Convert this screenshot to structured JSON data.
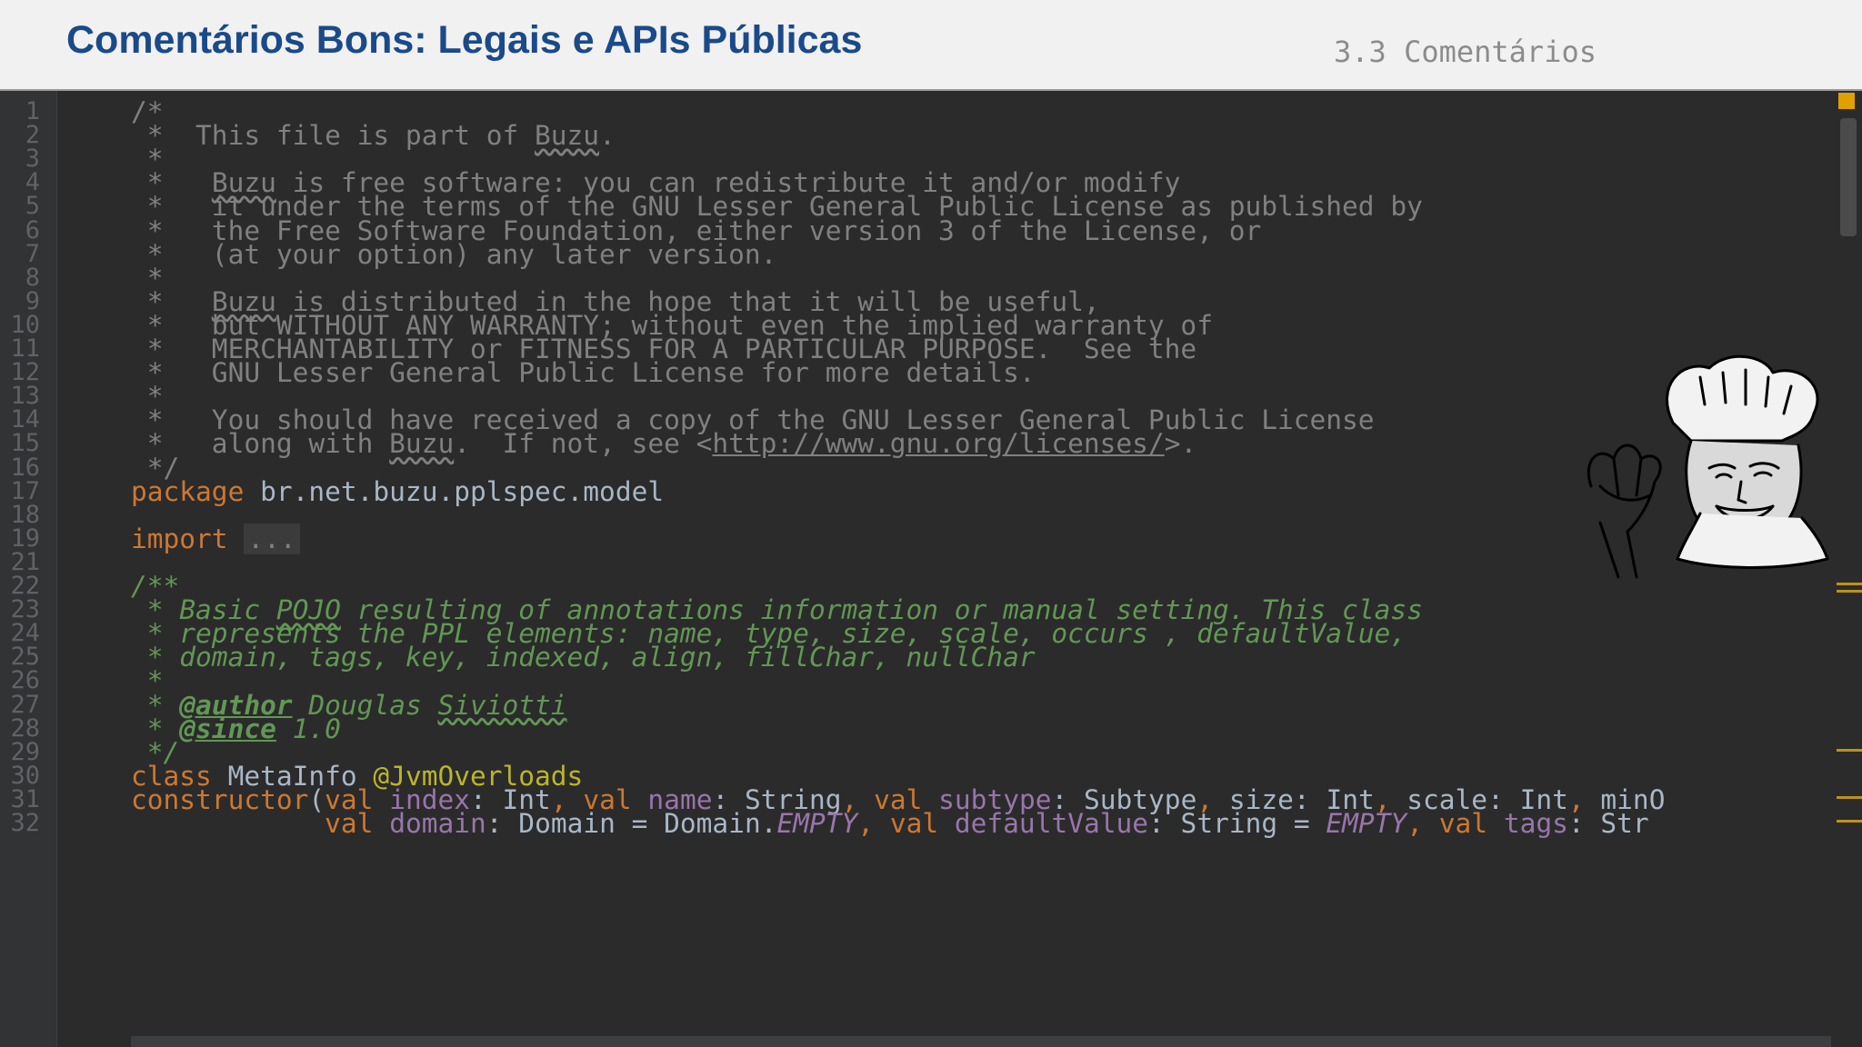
{
  "slide": {
    "title": "Comentários Bons: Legais e APIs Públicas",
    "section": "3.3 Comentários"
  },
  "editor": {
    "language": "Kotlin",
    "lines": [
      {
        "n": "1",
        "segments": [
          {
            "t": "/*",
            "c": "comment"
          }
        ]
      },
      {
        "n": "2",
        "segments": [
          {
            "t": " *  This file is part of ",
            "c": "comment"
          },
          {
            "t": "Buzu",
            "c": "comment squig"
          },
          {
            "t": ".",
            "c": "comment"
          }
        ]
      },
      {
        "n": "3",
        "segments": [
          {
            "t": " *",
            "c": "comment"
          }
        ]
      },
      {
        "n": "4",
        "segments": [
          {
            "t": " *   ",
            "c": "comment"
          },
          {
            "t": "Buzu",
            "c": "comment squig"
          },
          {
            "t": " is free software: you can redistribute it and/or modify",
            "c": "comment"
          }
        ]
      },
      {
        "n": "5",
        "segments": [
          {
            "t": " *   it under the terms of the GNU Lesser General Public License as published by",
            "c": "comment"
          }
        ]
      },
      {
        "n": "6",
        "segments": [
          {
            "t": " *   the Free Software Foundation, either version 3 of the License, or",
            "c": "comment"
          }
        ]
      },
      {
        "n": "7",
        "segments": [
          {
            "t": " *   (at your option) any later version.",
            "c": "comment"
          }
        ]
      },
      {
        "n": "8",
        "segments": [
          {
            "t": " *",
            "c": "comment"
          }
        ]
      },
      {
        "n": "9",
        "segments": [
          {
            "t": " *   ",
            "c": "comment"
          },
          {
            "t": "Buzu",
            "c": "comment squig"
          },
          {
            "t": " is distributed in the hope that it will be useful,",
            "c": "comment"
          }
        ]
      },
      {
        "n": "10",
        "segments": [
          {
            "t": " *   but WITHOUT ANY WARRANTY; without even the implied warranty of",
            "c": "comment"
          }
        ]
      },
      {
        "n": "11",
        "segments": [
          {
            "t": " *   MERCHANTABILITY or FITNESS FOR A PARTICULAR PURPOSE.  See the",
            "c": "comment"
          }
        ]
      },
      {
        "n": "12",
        "segments": [
          {
            "t": " *   GNU Lesser General Public License for more details.",
            "c": "comment"
          }
        ]
      },
      {
        "n": "13",
        "segments": [
          {
            "t": " *",
            "c": "comment"
          }
        ]
      },
      {
        "n": "14",
        "segments": [
          {
            "t": " *   You should have received a copy of the GNU Lesser General Public License",
            "c": "comment"
          }
        ]
      },
      {
        "n": "15",
        "segments": [
          {
            "t": " *   along with ",
            "c": "comment"
          },
          {
            "t": "Buzu",
            "c": "comment squig"
          },
          {
            "t": ".  If not, see <",
            "c": "comment"
          },
          {
            "t": "http://www.gnu.org/licenses/",
            "c": "link"
          },
          {
            "t": ">.",
            "c": "comment"
          }
        ]
      },
      {
        "n": "16",
        "segments": [
          {
            "t": " */",
            "c": "comment"
          }
        ]
      },
      {
        "n": "17",
        "segments": [
          {
            "t": "package",
            "c": "kw"
          },
          {
            "t": " br.net.buzu.pplspec.model",
            "c": ""
          }
        ]
      },
      {
        "n": "18",
        "segments": []
      },
      {
        "n": "19",
        "segments": [
          {
            "t": "import",
            "c": "kw"
          },
          {
            "t": " ",
            "c": ""
          },
          {
            "t": "...",
            "c": "fold"
          }
        ]
      },
      {
        "n": "21",
        "segments": []
      },
      {
        "n": "22",
        "segments": [
          {
            "t": "/**",
            "c": "doc"
          }
        ]
      },
      {
        "n": "23",
        "segments": [
          {
            "t": " * Basic ",
            "c": "doc"
          },
          {
            "t": "POJO",
            "c": "doc squig-doc"
          },
          {
            "t": " resulting of annotations information or manual setting. This class",
            "c": "doc"
          }
        ]
      },
      {
        "n": "24",
        "segments": [
          {
            "t": " * represents the PPL elements: name, type, size, scale, occurs , defaultValue,",
            "c": "doc"
          }
        ]
      },
      {
        "n": "25",
        "segments": [
          {
            "t": " * domain, tags, key, indexed, align, fillChar, nullChar",
            "c": "doc"
          }
        ]
      },
      {
        "n": "26",
        "segments": [
          {
            "t": " *",
            "c": "doc"
          }
        ]
      },
      {
        "n": "27",
        "segments": [
          {
            "t": " * ",
            "c": "doc"
          },
          {
            "t": "@author",
            "c": "doctag"
          },
          {
            "t": " Douglas ",
            "c": "doc"
          },
          {
            "t": "Siviotti",
            "c": "doc squig-doc"
          }
        ]
      },
      {
        "n": "28",
        "segments": [
          {
            "t": " * ",
            "c": "doc"
          },
          {
            "t": "@since",
            "c": "doctag"
          },
          {
            "t": " 1.0",
            "c": "doc"
          }
        ]
      },
      {
        "n": "29",
        "segments": [
          {
            "t": " */",
            "c": "doc"
          }
        ]
      },
      {
        "n": "30",
        "segments": [
          {
            "t": "class",
            "c": "kw"
          },
          {
            "t": " MetaInfo ",
            "c": ""
          },
          {
            "t": "@JvmOverloads",
            "c": "ann"
          }
        ]
      },
      {
        "n": "31",
        "segments": [
          {
            "t": "constructor",
            "c": "kw"
          },
          {
            "t": "(",
            "c": ""
          },
          {
            "t": "val",
            "c": "kw"
          },
          {
            "t": " ",
            "c": ""
          },
          {
            "t": "index",
            "c": "param"
          },
          {
            "t": ": Int",
            "c": ""
          },
          {
            "t": ", ",
            "c": "kw"
          },
          {
            "t": "val",
            "c": "kw"
          },
          {
            "t": " ",
            "c": ""
          },
          {
            "t": "name",
            "c": "param"
          },
          {
            "t": ": String",
            "c": ""
          },
          {
            "t": ", ",
            "c": "kw"
          },
          {
            "t": "val",
            "c": "kw"
          },
          {
            "t": " ",
            "c": ""
          },
          {
            "t": "subtype",
            "c": "param"
          },
          {
            "t": ": Subtype",
            "c": ""
          },
          {
            "t": ", ",
            "c": "kw"
          },
          {
            "t": "size: Int",
            "c": ""
          },
          {
            "t": ", ",
            "c": "kw"
          },
          {
            "t": "scale: Int",
            "c": ""
          },
          {
            "t": ", ",
            "c": "kw"
          },
          {
            "t": "minO",
            "c": ""
          }
        ]
      },
      {
        "n": "32",
        "segments": [
          {
            "t": "            ",
            "c": ""
          },
          {
            "t": "val",
            "c": "kw"
          },
          {
            "t": " ",
            "c": ""
          },
          {
            "t": "domain",
            "c": "param"
          },
          {
            "t": ": Domain = Domain.",
            "c": ""
          },
          {
            "t": "EMPTY",
            "c": "const"
          },
          {
            "t": ", ",
            "c": "kw"
          },
          {
            "t": "val",
            "c": "kw"
          },
          {
            "t": " ",
            "c": ""
          },
          {
            "t": "defaultValue",
            "c": "param"
          },
          {
            "t": ": String = ",
            "c": ""
          },
          {
            "t": "EMPTY",
            "c": "const"
          },
          {
            "t": ", ",
            "c": "kw"
          },
          {
            "t": "val",
            "c": "kw"
          },
          {
            "t": " ",
            "c": ""
          },
          {
            "t": "tags",
            "c": "param"
          },
          {
            "t": ": Str",
            "c": ""
          }
        ]
      }
    ]
  },
  "image": {
    "name": "chef-meme-illustration"
  }
}
